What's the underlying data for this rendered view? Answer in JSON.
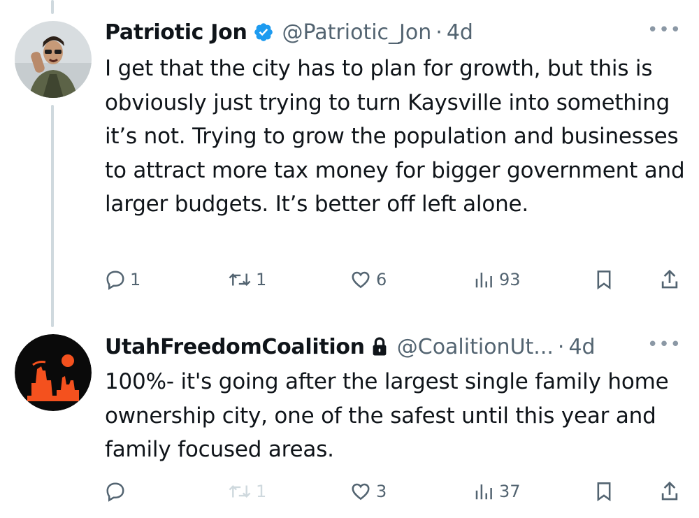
{
  "tweets": [
    {
      "author": {
        "name": "Patriotic Jon",
        "handle": "@Patriotic_Jon",
        "badge": "verified-badge-icon",
        "badge_color": "#1d9bf0"
      },
      "separator": "·",
      "time": "4d",
      "more_label": "•••",
      "text": "I get that the city has to plan for growth, but this is obviously just trying to turn Kaysville into something it’s not. Trying to grow the population and businesses to attract more tax money for bigger government and larger budgets. It’s better off left alone.",
      "stats": {
        "replies": "1",
        "retweets": "1",
        "likes": "6",
        "views": "93"
      }
    },
    {
      "author": {
        "name": "UtahFreedomCoalition",
        "handle": "@CoalitionUt...",
        "badge": "lock-icon",
        "badge_color": "#0f1419"
      },
      "separator": "·",
      "time": "4d",
      "more_label": "•••",
      "text": "100%- it's going after the largest single family home ownership city, one of the safest until this year and family focused areas.",
      "stats": {
        "replies": "",
        "retweets": "1",
        "likes": "3",
        "views": "37"
      }
    }
  ],
  "colors": {
    "text": "#0f1419",
    "secondary": "#536471",
    "thread_line": "#cfd9de",
    "coalition_logo_bg": "#0a0a0a",
    "coalition_logo_fg": "#f4511e"
  }
}
